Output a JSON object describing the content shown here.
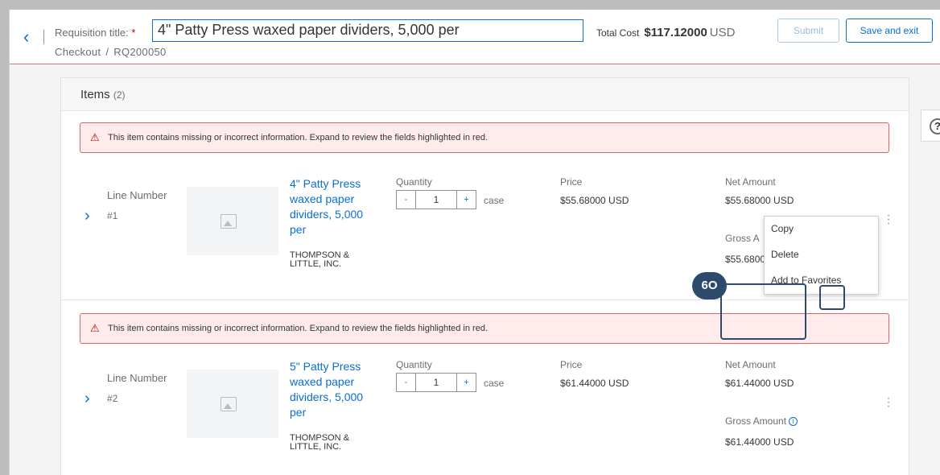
{
  "header": {
    "requisition_label": "Requisition title:",
    "required_mark": "*",
    "requisition_title": "4\" Patty Press waxed paper dividers, 5,000 per",
    "breadcrumb": [
      "Checkout",
      "RQ200050"
    ],
    "total_label": "Total Cost",
    "total_amount": "$117.12000",
    "total_currency": "USD",
    "submit_label": "Submit",
    "save_exit_label": "Save and exit"
  },
  "items": {
    "title": "Items",
    "count": "(2)",
    "warning_text": "This item contains missing or incorrect information. Expand to review the fields highlighted in red.",
    "rows": [
      {
        "line_label": "Line Number",
        "line_number": "#1",
        "name": "4\" Patty Press waxed paper dividers, 5,000 per",
        "supplier": "THOMPSON & LITTLE, INC.",
        "quantity_label": "Quantity",
        "quantity": "1",
        "unit": "case",
        "price_label": "Price",
        "price": "$55.68000  USD",
        "net_label": "Net Amount",
        "net": "$55.68000  USD",
        "gross_label": "Gross A",
        "gross": "$55.6800"
      },
      {
        "line_label": "Line Number",
        "line_number": "#2",
        "name": "5\" Patty Press waxed paper dividers, 5,000 per",
        "supplier": "THOMPSON & LITTLE, INC.",
        "quantity_label": "Quantity",
        "quantity": "1",
        "unit": "case",
        "price_label": "Price",
        "price": "$61.44000  USD",
        "net_label": "Net Amount",
        "net": "$61.44000  USD",
        "gross_label": "Gross Amount",
        "gross": "$61.44000  USD"
      }
    ]
  },
  "stepper": {
    "minus": "-",
    "plus": "+"
  },
  "context_menu": {
    "items": [
      "Copy",
      "Delete",
      "Add to Favorites"
    ]
  },
  "annotation": {
    "step": "6O"
  },
  "help": {
    "symbol": "?"
  },
  "colors": {
    "accent": "#0a6ed1",
    "error": "#bb0000",
    "annotation": "#2d4a6d"
  }
}
